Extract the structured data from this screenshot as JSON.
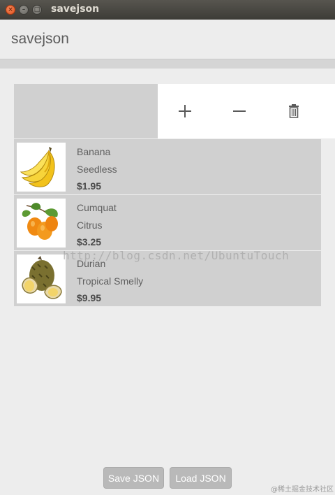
{
  "window": {
    "title": "savejson",
    "buttons": [
      "close",
      "minimize",
      "maximize"
    ]
  },
  "header": {
    "title": "savejson"
  },
  "actions": [
    {
      "name": "add-icon"
    },
    {
      "name": "remove-icon"
    },
    {
      "name": "trash-icon"
    }
  ],
  "items": [
    {
      "name": "Banana",
      "description": "Seedless",
      "price": "$1.95",
      "image": "banana"
    },
    {
      "name": "Cumquat",
      "description": "Citrus",
      "price": "$3.25",
      "image": "cumquat"
    },
    {
      "name": "Durian",
      "description": "Tropical Smelly",
      "price": "$9.95",
      "image": "durian"
    }
  ],
  "watermark": "http://blog.csdn.net/UbuntuTouch",
  "corner_mark": "@稀土掘金技术社区",
  "buttons": {
    "save": "Save JSON",
    "load": "Load JSON"
  },
  "colors": {
    "titlebar": "#3d3c37",
    "close_button": "#e0511d",
    "row_bg": "#d0d0d0",
    "button_bg": "#b9b9b9"
  }
}
